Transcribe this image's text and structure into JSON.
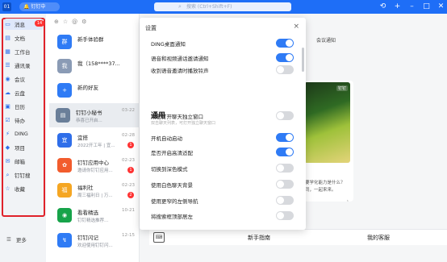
{
  "titlebar": {
    "avatar": "01",
    "org_name": "🔔 钉钉中",
    "search_placeholder": "搜索 (Ctrl+Shift+F)",
    "icons": [
      "history-icon",
      "add-icon",
      "minimize-icon",
      "maximize-icon",
      "close-icon"
    ]
  },
  "sidebar": {
    "items": [
      {
        "label": "消息",
        "icon": "chat-icon",
        "badge": "14"
      },
      {
        "label": "文档",
        "icon": "document-icon"
      },
      {
        "label": "工作台",
        "icon": "workbench-icon"
      },
      {
        "label": "通讯录",
        "icon": "contacts-icon"
      },
      {
        "label": "会议",
        "icon": "meeting-icon"
      },
      {
        "label": "云盘",
        "icon": "cloud-icon"
      },
      {
        "label": "日历",
        "icon": "calendar-icon"
      },
      {
        "label": "待办",
        "icon": "todo-icon"
      },
      {
        "label": "DING",
        "icon": "ding-icon"
      },
      {
        "label": "项目",
        "icon": "project-icon"
      },
      {
        "label": "邮箱",
        "icon": "mail-icon"
      },
      {
        "label": "钉钉搜",
        "icon": "search-icon"
      },
      {
        "label": "收藏",
        "icon": "star-icon"
      }
    ],
    "more_label": "更多"
  },
  "conversations": [
    {
      "name": "新手体验群",
      "sub": "",
      "time": "",
      "badge": "",
      "color": "#2f7bf5"
    },
    {
      "name": "我（158****37...",
      "sub": "",
      "time": "",
      "badge": "",
      "color": "#8a9bb5"
    },
    {
      "name": "新的好友",
      "sub": "",
      "time": "",
      "badge": "",
      "color": "#2f7bf5"
    },
    {
      "name": "钉钉小秘书",
      "sub": "恭喜已开启...",
      "time": "03-22",
      "badge": "",
      "color": "#6a7f99"
    },
    {
      "name": "宜搭",
      "sub": "2022开工年 | 宜...",
      "time": "02-28",
      "badge": "1",
      "color": "#2f6ee9"
    },
    {
      "name": "钉钉应用中心",
      "sub": "邀请你钉钉应用...",
      "time": "02-23",
      "badge": "1",
      "color": "#f25c2d"
    },
    {
      "name": "福利社",
      "sub": "周三福利日 | 万...",
      "time": "02-23",
      "badge": "2",
      "color": "#f5a623"
    },
    {
      "name": "看看精选",
      "sub": "钉钉精选推荐...",
      "time": "10-21",
      "badge": "",
      "color": "#17a34a"
    },
    {
      "name": "钉钉闪记",
      "sub": "欢迎使用钉钉闪...",
      "time": "12-15",
      "badge": "",
      "color": "#2f7bf5"
    }
  ],
  "settings": {
    "title": "设置",
    "rows_top": [
      {
        "label": "DING桌面通知",
        "on": true
      },
      {
        "label": "语音和视频通话邀请通知",
        "on": true
      },
      {
        "label": "收到语音邀请时播放铃声",
        "on": false
      }
    ],
    "section": "通用",
    "rows_general": [
      {
        "label": "双击打开聊天独立窗口",
        "hint": "双击聊天列表，可打开独立聊天窗口",
        "on": false
      },
      {
        "label": "开机自动启动",
        "on": true
      },
      {
        "label": "是否开启高清适配",
        "on": true
      },
      {
        "label": "切换到深色模式",
        "on": false
      },
      {
        "label": "使用白色聊天背景",
        "on": false
      },
      {
        "label": "使用更窄的左侧导航",
        "on": false
      },
      {
        "label": "将搜索框顶部居左",
        "on": false
      }
    ]
  },
  "chat": {
    "card_text_1": "新春新机...",
    "card_text_2": "",
    "side_text_1": "会议通知",
    "side_text_2": "",
    "card_logo": "钉钉",
    "extra_text_a": "要学化能力是什么？",
    "extra_text_b": "同，一起来来。",
    "bottom_left": "新手指南",
    "bottom_right": "我的客服"
  }
}
